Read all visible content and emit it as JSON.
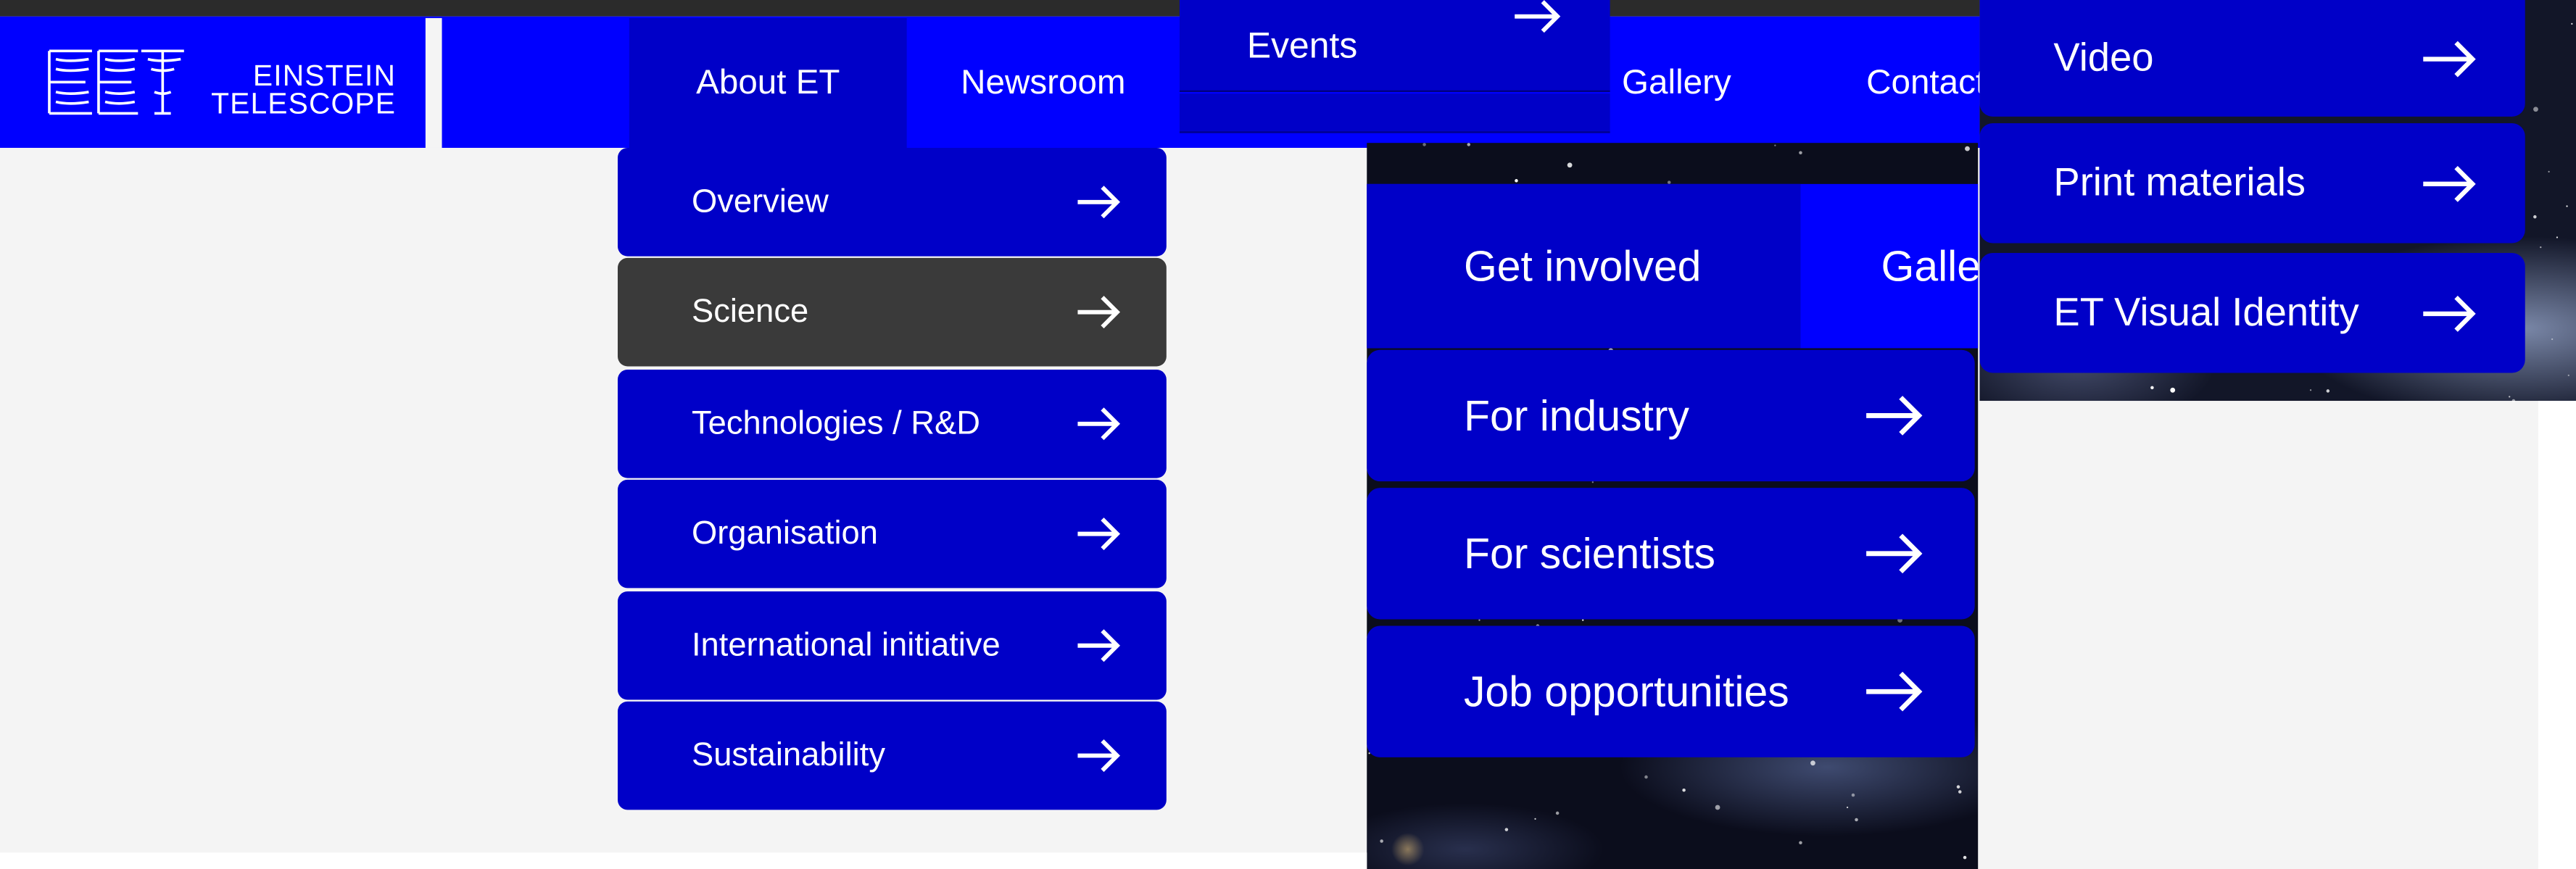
{
  "brand": {
    "line1": "EINSTEIN",
    "line2": "TELESCOPE",
    "mark": "ET"
  },
  "nav": {
    "about": "About ET",
    "newsroom": "Newsroom",
    "gallery": "Gallery",
    "contact": "Contact"
  },
  "newsroom_menu": {
    "events": "Events"
  },
  "about_menu": [
    {
      "label": "Overview"
    },
    {
      "label": "Science",
      "active": true
    },
    {
      "label": "Technologies / R&D"
    },
    {
      "label": "Organisation"
    },
    {
      "label": "International initiative"
    },
    {
      "label": "Sustainability"
    }
  ],
  "get_involved": {
    "label": "Get involved",
    "next_tab": "Gallery",
    "items": [
      {
        "label": "For industry"
      },
      {
        "label": "For scientists"
      },
      {
        "label": "Job opportunities"
      }
    ]
  },
  "gallery_menu": [
    {
      "label": "Video"
    },
    {
      "label": "Print materials"
    },
    {
      "label": "ET Visual Identity"
    }
  ],
  "colors": {
    "primary": "#0000ff",
    "dark_blue": "#0000c8",
    "active": "#3a3a3a",
    "background": "#f4f4f4"
  },
  "icons": {
    "menu_arrow": "arrow-right-icon"
  }
}
